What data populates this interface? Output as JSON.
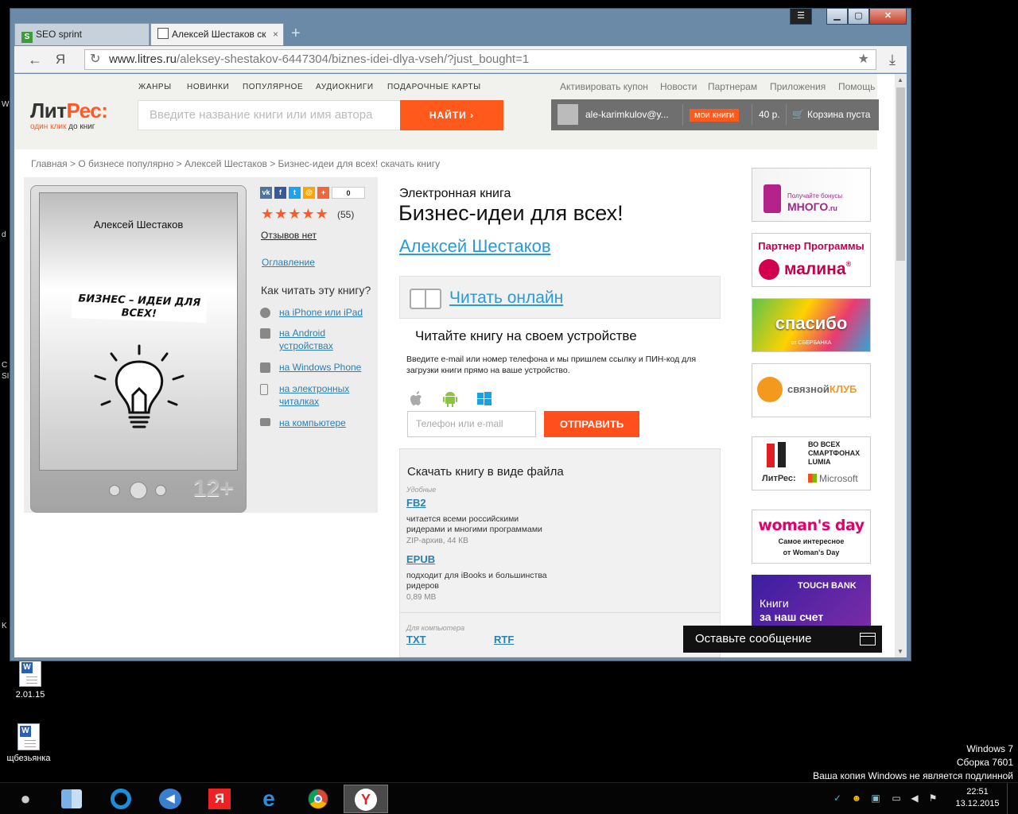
{
  "desktop": {
    "icons": [
      {
        "label": "2.01.15"
      },
      {
        "label": "щбезьянка"
      }
    ],
    "edge_chars": [
      "W",
      "d",
      "C",
      "SI",
      "K"
    ],
    "watermark": {
      "line1": "Windows 7",
      "line2": "Сборка 7601",
      "line3": "Ваша копия Windows не является подлинной"
    }
  },
  "browser": {
    "tabs": [
      {
        "label": "SEO sprint"
      },
      {
        "label": "Алексей Шестаков ск",
        "close": "×"
      }
    ],
    "new_tab": "+",
    "back_icon": "←",
    "yandex_icon": "Я",
    "url": {
      "domain": "www.litres.ru",
      "path": "/aleksey-shestakov-6447304/biznes-idei-dlya-vseh/?just_bought=1"
    },
    "reload_icon": "↻",
    "star_icon": "★",
    "download_icon": "⤓"
  },
  "site": {
    "nav": [
      "ЖАНРЫ",
      "НОВИНКИ",
      "ПОПУЛЯРНОЕ",
      "АУДИОКНИГИ",
      "ПОДАРОЧНЫЕ КАРТЫ"
    ],
    "top_links": [
      "Активировать купон",
      "Новости",
      "Партнерам",
      "Приложения",
      "Помощь"
    ],
    "logo": {
      "part1": "Лит",
      "part2": "Рес:"
    },
    "slogan": {
      "part1": "один клик",
      "part2": " до книг"
    },
    "search": {
      "placeholder": "Введите название книги или имя автора",
      "button": "НАЙТИ"
    },
    "user": {
      "email": "ale-karimkulov@y...",
      "my_books": "мои книги",
      "balance": "40 р.",
      "cart": "Корзина пуста"
    }
  },
  "breadcrumb": "Главная > О бизнесе популярно > Алексей Шестаков > Бизнес-идеи для всех! скачать книгу",
  "cover": {
    "author": "Алексей Шестаков",
    "title": "БИЗНЕС – ИДЕИ ДЛЯ ВСЕХ!",
    "age": "12+"
  },
  "share": {
    "count": "0"
  },
  "rating": {
    "stars": "★★★★★",
    "count": "(55)"
  },
  "reviews": "Отзывов нет",
  "toc": "Оглавление",
  "howto": {
    "title": "Как читать эту книгу?",
    "items": [
      {
        "label": "на iPhone или iPad"
      },
      {
        "label1": "на Android",
        "label2": "устройствах"
      },
      {
        "label": "на Windows Phone"
      },
      {
        "label1": "на электронных",
        "label2": "читалках"
      },
      {
        "label": "на компьютере"
      }
    ]
  },
  "book": {
    "type": "Электронная книга",
    "title": "Бизнес-идеи для всех!",
    "author": "Алексей Шестаков"
  },
  "read_online": "Читать онлайн",
  "device": {
    "title": "Читайте книгу на своем устройстве",
    "desc": "Введите e-mail или номер телефона и мы пришлем ссылку и ПИН-код для загрузки книги прямо на ваше устройство.",
    "placeholder": "Телефон или e-mail",
    "send": "ОТПРАВИТЬ"
  },
  "download": {
    "title": "Скачать книгу в виде файла",
    "cat1": "Удобные",
    "formats": [
      {
        "name": "FB2",
        "desc1": "читается всеми российскими",
        "desc2": "ридерами и многими программами",
        "size": "ZIP-архив, 44 КВ"
      },
      {
        "name": "EPUB",
        "desc1": "подходит для iBooks и большинства",
        "desc2": "ридеров",
        "size": "0,89 МВ"
      }
    ],
    "cat2": "Для компьютера",
    "pc_formats": [
      "TXT",
      "RTF"
    ]
  },
  "ads": {
    "mnogo": {
      "line1": "Получайте бонусы",
      "line2": "МНОГО",
      "line3": ".ru"
    },
    "malina": {
      "line1": "Партнер Программы",
      "line2": "малина",
      "mark": "®"
    },
    "spasibo": {
      "line1": "спасибо",
      "line2": "от СБЕРБАНКА"
    },
    "svyaznoy": {
      "line1": "связной",
      "line2": "КЛУБ"
    },
    "lumia": {
      "line1": "ВО ВСЕХ",
      "line2": "СМАРТФОНАХ",
      "line3": "LUMIA",
      "brand": "ЛитРес:",
      "ms": "Microsoft"
    },
    "womansday": {
      "line1": "woman's day",
      "line2": "Самое интересное",
      "line3": "от Woman's Day"
    },
    "touchbank": {
      "line1": "TOUCH BANK",
      "line2": "Книги",
      "line3": "за наш счет"
    }
  },
  "chat": "Оставьте сообщение",
  "clock": {
    "time": "22:51",
    "date": "13.12.2015"
  },
  "colors": {
    "accent": "#ff5a1c",
    "link": "#2b9ad8",
    "link_dark": "#2b7fb3"
  }
}
